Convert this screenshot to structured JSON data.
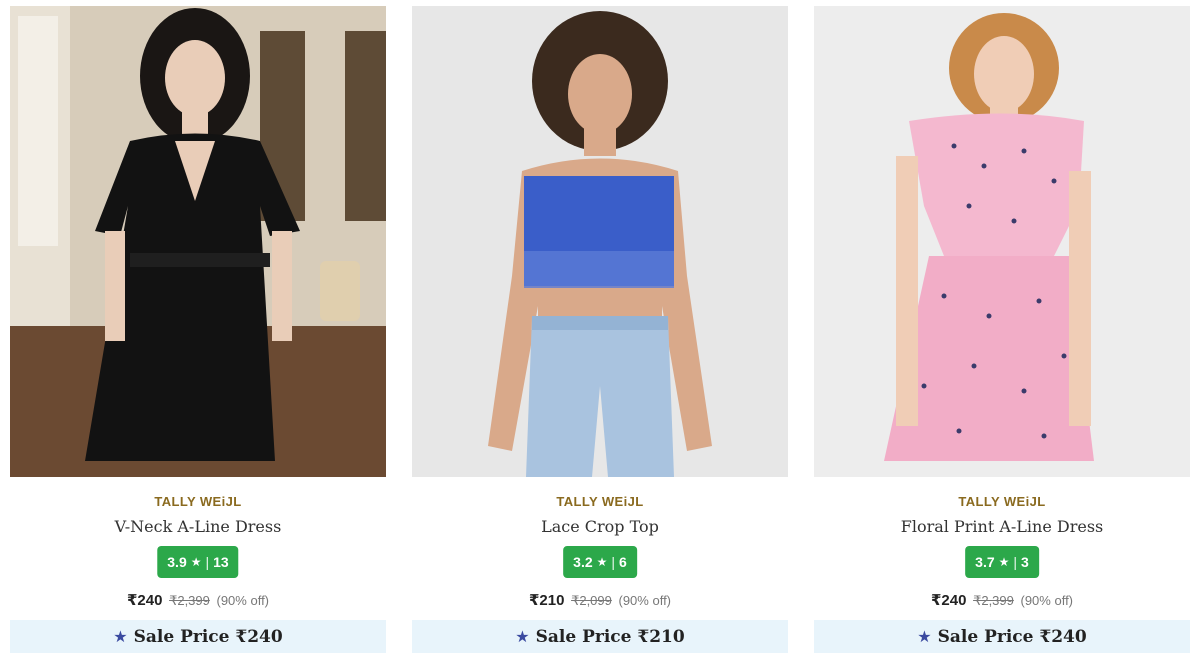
{
  "products": [
    {
      "brand": "TALLY WEiJL",
      "name": "V-Neck A-Line Dress",
      "rating": "3.9",
      "rating_count": "13",
      "price": "₹240",
      "mrp": "₹2,399",
      "discount": "(90% off)",
      "sale_label": "Sale Price ₹240",
      "image": {
        "description_colors": {
          "bg": "#cfc2ae",
          "garment": "#111111",
          "floor": "#6b4a32"
        },
        "icon": "product-photo"
      }
    },
    {
      "brand": "TALLY WEiJL",
      "name": "Lace Crop Top",
      "rating": "3.2",
      "rating_count": "6",
      "price": "₹210",
      "mrp": "₹2,099",
      "discount": "(90% off)",
      "sale_label": "Sale Price ₹210",
      "image": {
        "description_colors": {
          "bg": "#e6e6e6",
          "garment": "#3a5ec9",
          "jeans": "#a9c3df"
        },
        "icon": "product-photo"
      }
    },
    {
      "brand": "TALLY WEiJL",
      "name": "Floral Print A-Line Dress",
      "rating": "3.7",
      "rating_count": "3",
      "price": "₹240",
      "mrp": "₹2,399",
      "discount": "(90% off)",
      "sale_label": "Sale Price ₹240",
      "image": {
        "description_colors": {
          "bg": "#ececec",
          "garment": "#f4b8cf"
        },
        "icon": "product-photo"
      }
    }
  ],
  "icons": {
    "rating": "star-icon",
    "sale": "star-icon"
  },
  "colors": {
    "rating_badge": "#2ca84a",
    "brand": "#8a6a1f",
    "sale_bar": "#e8f4fb",
    "sale_star": "#3a4aa0"
  }
}
